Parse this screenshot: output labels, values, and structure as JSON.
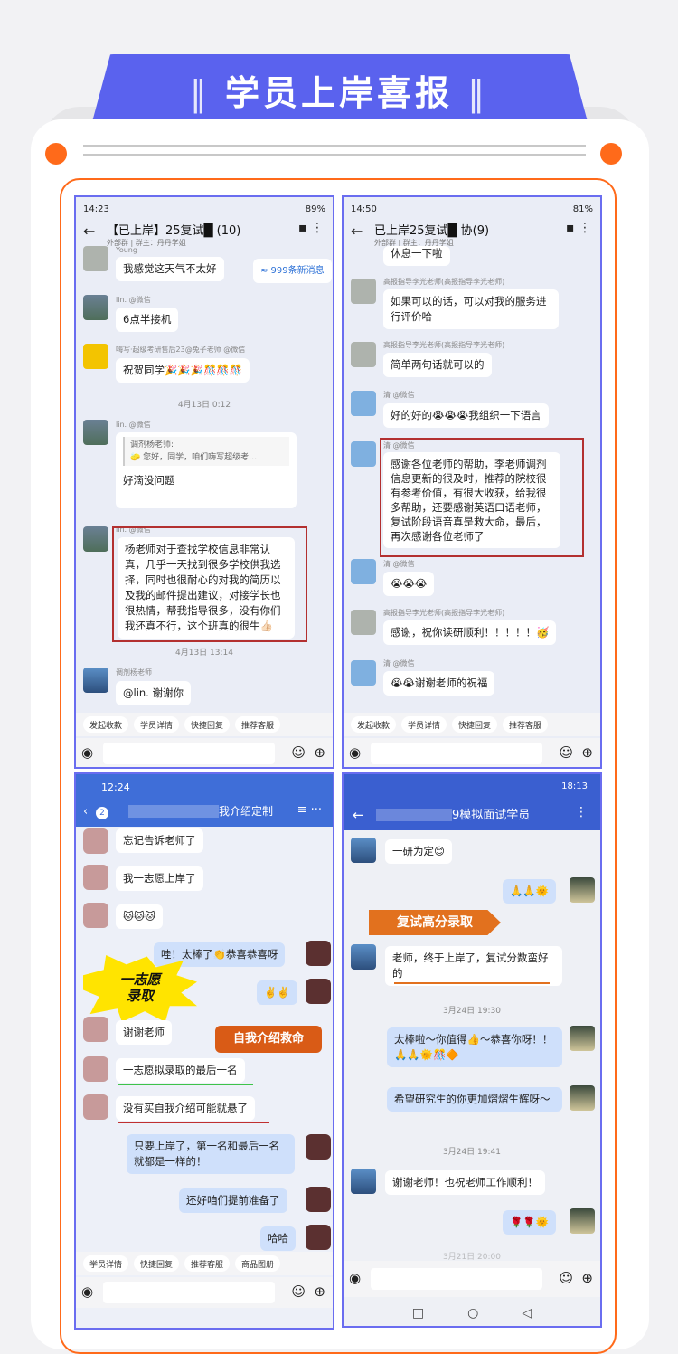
{
  "title": "学员上岸喜报",
  "s1": {
    "time": "14:23",
    "battery": "89%",
    "chat": "【已上岸】25复试█ (10)",
    "sub": "外部群 | 群主：丹丹学姐",
    "unread": "≈ 999条新消息",
    "n1": "Young",
    "m1": "我感觉这天气不太好",
    "n2": "lin. @微信",
    "m2": "6点半接机",
    "n3": "嗨写·超级考研售后23@兔子老师 @微信",
    "m3": "祝贺同学🎉🎉🎉🎊🎊🎊",
    "t1": "4月13日 0:12",
    "n4": "lin. @微信",
    "q1": "调剂杨老师:",
    "q2": "🧽 您好，同学，咱们嗨写超级考…",
    "m4": "好滴没问题",
    "n5": "lin. @微信",
    "m5": "杨老师对于查找学校信息非常认真，几乎一天找到很多学校供我选择，同时也很耐心的对我的简历以及我的邮件提出建议，对接学长也很热情，帮我指导很多，没有你们我还真不行，这个班真的很牛👍🏻",
    "t2": "4月13日 13:14",
    "n6": "调剂杨老师",
    "m6": "@lin. 谢谢你",
    "pills": [
      "发起收款",
      "学员详情",
      "快捷回复",
      "推荐客服"
    ]
  },
  "s2": {
    "time": "14:50",
    "battery": "81%",
    "chat": "已上岸25复试█ 协(9)",
    "sub": "外部群 | 群主：丹丹学姐",
    "m0": "休息一下啦",
    "n1": "高报指导李光老师(高报指导李光老师)",
    "m1": "如果可以的话，可以对我的服务进行评价哈",
    "n2": "高报指导李光老师(高报指导李光老师)",
    "m2": "简单两句话就可以的",
    "n3": "清 @微信",
    "m3": "好的好的😭😭😭我组织一下语言",
    "n4": "清 @微信",
    "m4": "感谢各位老师的帮助，李老师调剂信息更新的很及时，推荐的院校很有参考价值，有很大收获，给我很多帮助，还要感谢英语口语老师，复试阶段语音真是救大命，最后，再次感谢各位老师了",
    "n5": "清 @微信",
    "m5": "😭😭😭",
    "n6": "高报指导李光老师(高报指导李光老师)",
    "m6": "感谢，祝你读研顺利！！！！！🥳",
    "n7": "清 @微信",
    "m7": "😭😭谢谢老师的祝福",
    "pills": [
      "发起收款",
      "学员详情",
      "快捷回复",
      "推荐客服"
    ]
  },
  "s3": {
    "time": "12:24",
    "badge": "2",
    "chat": "我介绍定制",
    "m1": "忘记告诉老师了",
    "m2": "我一志愿上岸了",
    "m3": "🐱🐱🐱",
    "m4": "哇！太棒了👏恭喜恭喜呀",
    "m5": "✌️✌️",
    "sticker1a": "一志愿",
    "sticker1b": "录取",
    "m6": "谢谢老师",
    "sticker2": "自我介绍救命",
    "m7": "一志愿拟录取的最后一名",
    "m8": "没有买自我介绍可能就悬了",
    "m9": "只要上岸了，第一名和最后一名就都是一样的！",
    "m10": "还好咱们提前准备了",
    "m11": "哈哈",
    "pills": [
      "学员详情",
      "快捷回复",
      "推荐客服",
      "商品图册"
    ]
  },
  "s4": {
    "time": "18:13",
    "chat": "9模拟面试学员",
    "m1": "一研为定😊",
    "m2": "🙏🙏🌞",
    "banner": "复试高分录取",
    "m3": "老师，终于上岸了，复试分数蛮好的",
    "t1": "3月24日 19:30",
    "m4": "太棒啦～你值得👍～恭喜你呀！！🙏🙏🌞🎊🔶",
    "m5": "希望研究生的你更加熠熠生辉呀～",
    "t2": "3月24日 19:41",
    "m6": "谢谢老师！也祝老师工作顺利！",
    "m7": "🌹🌹🌞",
    "t3": "3月21日 20:00"
  }
}
